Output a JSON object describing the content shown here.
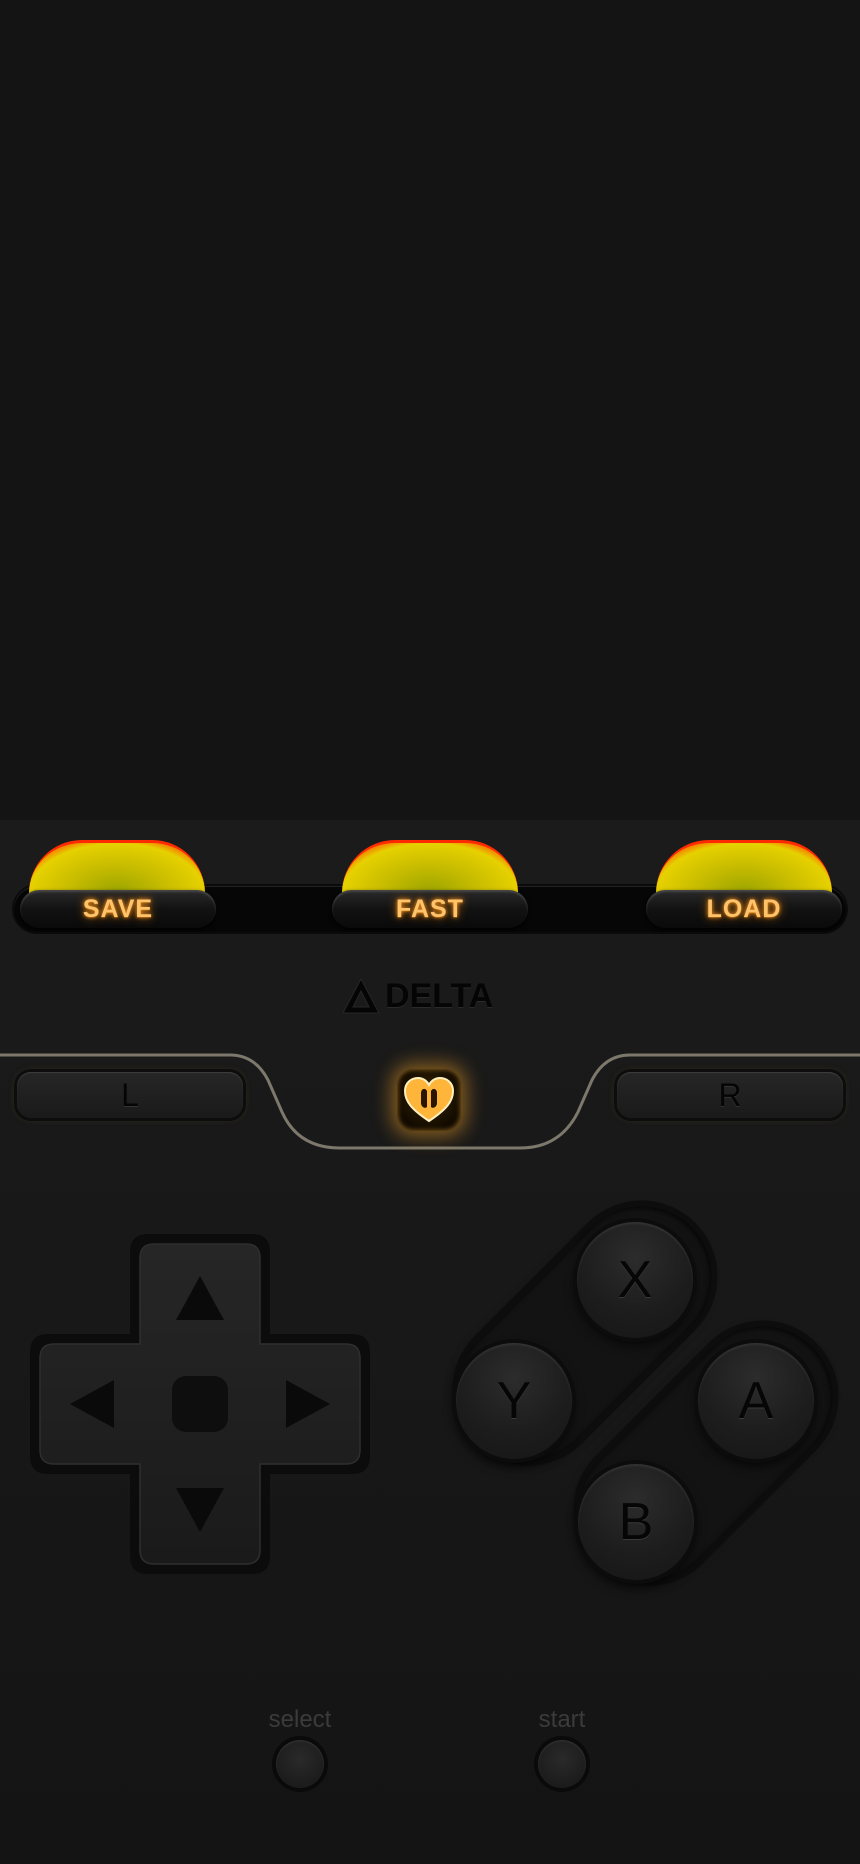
{
  "app": {
    "logo_text": "DELTA",
    "logo_icon": "delta-triangle-icon"
  },
  "action_bar": {
    "save_label": "SAVE",
    "fast_label": "FAST",
    "load_label": "LOAD",
    "glow_color": "#ffc46b"
  },
  "shoulder": {
    "left_label": "L",
    "right_label": "R",
    "menu_icon": "heart-menu-icon"
  },
  "dpad": {
    "icons": [
      "arrow-up-icon",
      "arrow-left-icon",
      "arrow-right-icon",
      "arrow-down-icon"
    ]
  },
  "face_buttons": {
    "x": "X",
    "y": "Y",
    "a": "A",
    "b": "B"
  },
  "system": {
    "select_label": "select",
    "start_label": "start"
  }
}
